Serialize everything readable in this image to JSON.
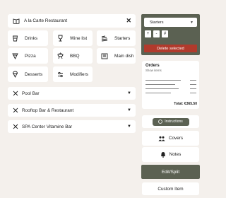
{
  "restaurant": {
    "title": "A la Carte Restaurant",
    "close_label": "✕"
  },
  "categories": [
    {
      "label": "Drinks",
      "icon": "glass-icon"
    },
    {
      "label": "Wine list",
      "icon": "wine-glass-icon"
    },
    {
      "label": "Starters",
      "icon": "starters-icon"
    },
    {
      "label": "Pizza",
      "icon": "pizza-icon"
    },
    {
      "label": "BBQ",
      "icon": "bbq-grill-icon"
    },
    {
      "label": "Main dish",
      "icon": "main-dish-icon"
    },
    {
      "label": "Desserts",
      "icon": "dessert-icon"
    },
    {
      "label": "Modifiers",
      "icon": "modifiers-icon"
    }
  ],
  "venues": [
    {
      "label": "Pool Bar",
      "icon": "utensils-icon",
      "caret": "▼"
    },
    {
      "label": "Rooftop Bar & Restaurant",
      "icon": "utensils-icon",
      "caret": "▼"
    },
    {
      "label": "SPA Center Vitamine Bar",
      "icon": "utensils-icon",
      "caret": "▼"
    }
  ],
  "panel": {
    "selected_category": "Starters",
    "select_caret": "▼",
    "plus": "+",
    "minus": "-",
    "hash": "#",
    "delete_label": "Delete selected"
  },
  "orders": {
    "title": "Orders",
    "subtitle": "Show items",
    "total": "Total: €365.50"
  },
  "actions": {
    "instructions": "Instructions",
    "covers": "Covers",
    "notes": "Notes",
    "edit_split": "Edit/Split",
    "custom_item": "Custom Item"
  },
  "colors": {
    "background": "#f4f0ec",
    "accent": "#5b6152",
    "danger": "#b13a2c"
  }
}
